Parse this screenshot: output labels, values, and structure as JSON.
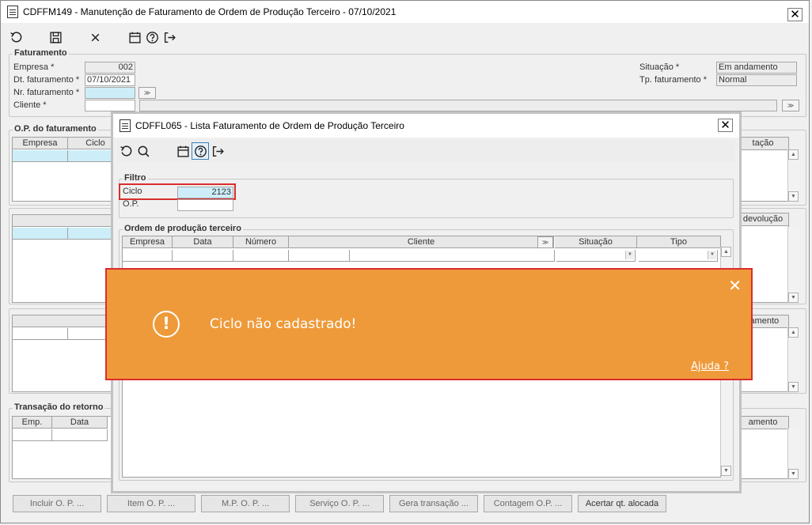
{
  "main": {
    "title": "CDFFM149 - Manutenção de Faturamento de Ordem de Produção Terceiro - 07/10/2021",
    "toolbar": [
      "undo-icon",
      "save-icon",
      "close-icon",
      "calendar-icon",
      "help-icon",
      "exit-icon"
    ],
    "faturamento": {
      "title": "Faturamento",
      "empresa_label": "Empresa *",
      "empresa_value": "002",
      "dt_label": "Dt. faturamento *",
      "dt_value": "07/10/2021",
      "nr_label": "Nr. faturamento *",
      "nr_value": "",
      "cliente_label": "Cliente *",
      "cliente_value": "",
      "situacao_label": "Situação *",
      "situacao_value": "Em andamento",
      "tp_label": "Tp. faturamento *",
      "tp_value": "Normal"
    },
    "op_group": {
      "title": "O.P. do faturamento",
      "col_empresa": "Empresa",
      "col_ciclo": "Ciclo",
      "col_right": "tação"
    },
    "grid2_right_button": "devolução",
    "grid3_right_button": "ramento",
    "retorno": {
      "title": "Transação do retorno",
      "col_emp": "Emp.",
      "col_data": "Data",
      "col_right": "amento"
    },
    "buttons": {
      "incluir": "Incluir O. P. ...",
      "item": "Item O. P. ...",
      "mp": "M.P. O. P. ...",
      "servico": "Serviço O. P. ...",
      "gera": "Gera transação ...",
      "contagem": "Contagem O.P. ...",
      "acertar": "Acertar qt. alocada"
    }
  },
  "dialog": {
    "title": "CDFFL065 - Lista Faturamento de Ordem de Produção Terceiro",
    "toolbar": [
      "undo-icon",
      "search-icon",
      "calendar-icon",
      "help-icon",
      "exit-icon"
    ],
    "filtro": {
      "title": "Filtro",
      "ciclo_label": "Ciclo",
      "ciclo_value": "2123",
      "op_label": "O.P.",
      "op_value": ""
    },
    "ordem": {
      "title": "Ordem de produção terceiro",
      "columns": [
        "Empresa",
        "Data",
        "Número",
        "Cliente",
        "Situação",
        "Tipo"
      ]
    }
  },
  "toast": {
    "message": "Ciclo não cadastrado!",
    "help_link": "Ajuda ?",
    "background": "#ee9a3a",
    "border": "#d92d2d"
  }
}
